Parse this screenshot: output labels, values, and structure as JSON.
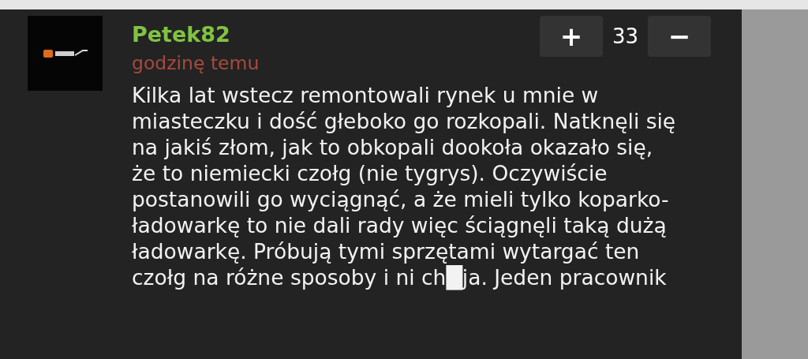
{
  "comment": {
    "author": "Petek82",
    "time": "godzinę temu",
    "vote": {
      "plus": "+",
      "score": "33",
      "minus": "−"
    },
    "body_lines": [
      "Kilka lat wstecz remontowali rynek u mnie w",
      "miasteczku i dość głeboko go rozkopali. Natknęli się",
      "na jakiś złom, jak to obkopali dookoła okazało się,",
      "że to niemiecki czołg (nie tygrys). Oczywiście",
      "postanowili go wyciągnąć, a że mieli tylko koparko-",
      "ładowarkę to nie dali rady więc ściągnęli taką dużą",
      "ładowarkę. Próbują tymi sprzętami wytargać ten",
      "czołg na różne sposoby i ni ch█ja. Jeden pracownik"
    ]
  }
}
